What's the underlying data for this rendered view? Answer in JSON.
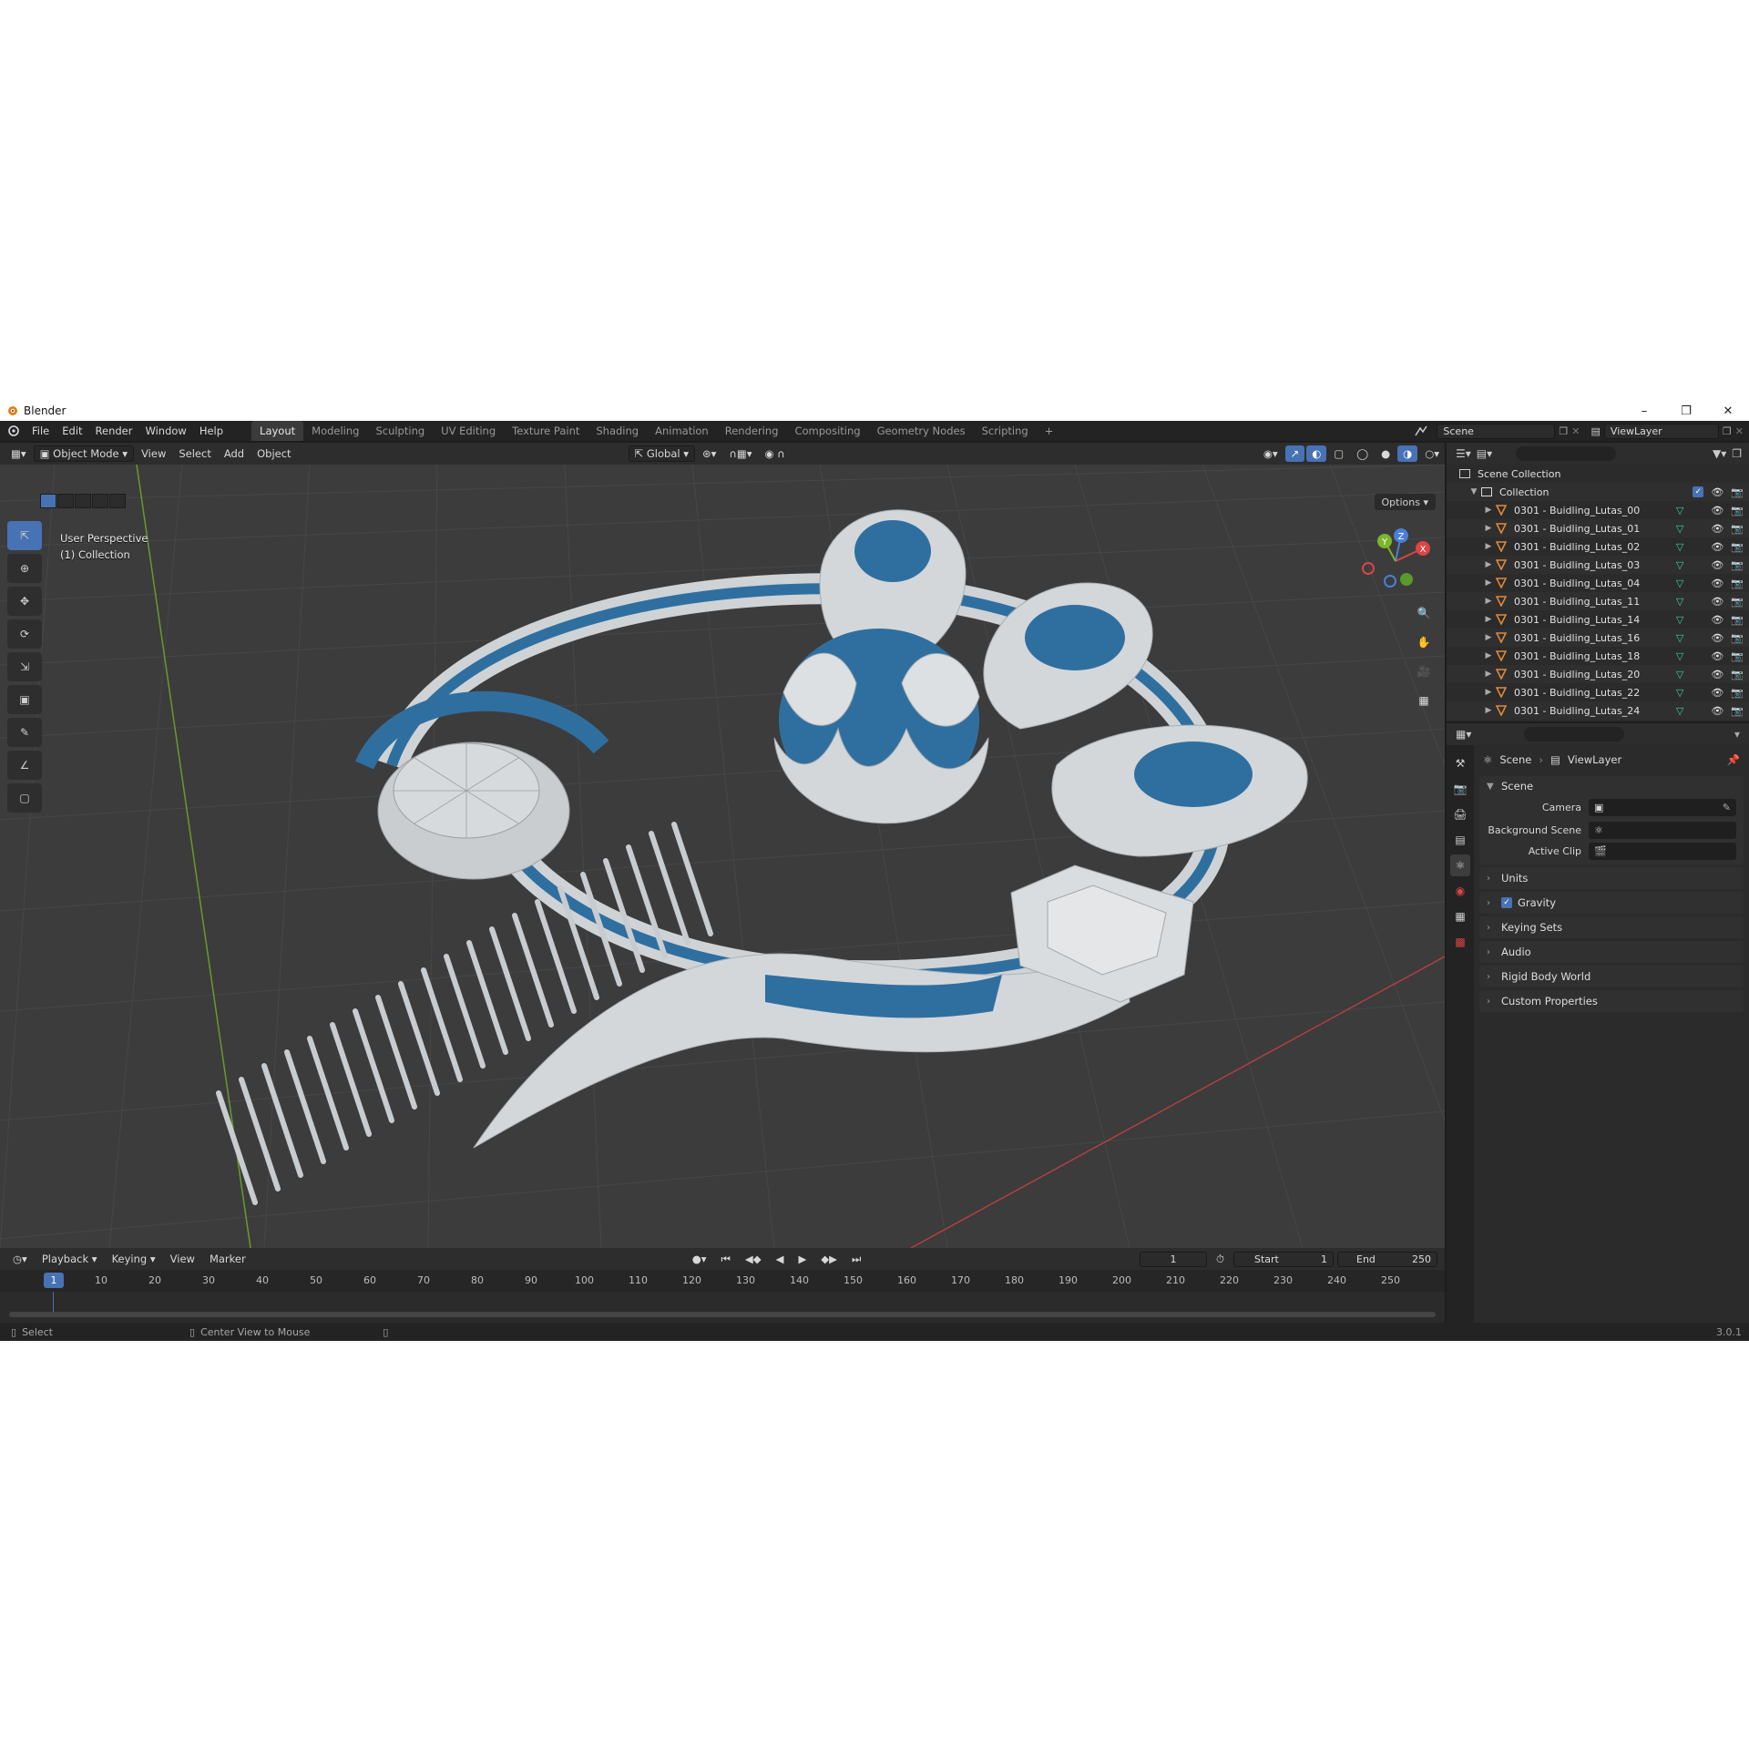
{
  "window": {
    "title": "Blender"
  },
  "menu": [
    "File",
    "Edit",
    "Render",
    "Window",
    "Help"
  ],
  "workspaces": [
    "Layout",
    "Modeling",
    "Sculpting",
    "UV Editing",
    "Texture Paint",
    "Shading",
    "Animation",
    "Rendering",
    "Compositing",
    "Geometry Nodes",
    "Scripting"
  ],
  "scene_field": "Scene",
  "viewlayer_field": "ViewLayer",
  "viewport": {
    "mode": "Object Mode",
    "menus": [
      "View",
      "Select",
      "Add",
      "Object"
    ],
    "orientation": "Global",
    "options_label": "Options",
    "info_line1": "User Perspective",
    "info_line2": "(1) Collection"
  },
  "gizmo": {
    "x": "X",
    "y": "Y",
    "z": "Z"
  },
  "timeline": {
    "menus": [
      "Playback",
      "Keying",
      "View",
      "Marker"
    ],
    "current_frame": "1",
    "start_label": "Start",
    "start_value": "1",
    "end_label": "End",
    "end_value": "250",
    "ruler_current": "1",
    "ticks": [
      "10",
      "20",
      "30",
      "40",
      "50",
      "60",
      "70",
      "80",
      "90",
      "100",
      "110",
      "120",
      "130",
      "140",
      "150",
      "160",
      "170",
      "180",
      "190",
      "200",
      "210",
      "220",
      "230",
      "240",
      "250"
    ]
  },
  "statusbar": {
    "select": "Select",
    "center": "Center View to Mouse",
    "version": "3.0.1"
  },
  "outliner": {
    "scene_collection": "Scene Collection",
    "collection": "Collection",
    "objects": [
      "0301 - Buidling_Lutas_00",
      "0301 - Buidling_Lutas_01",
      "0301 - Buidling_Lutas_02",
      "0301 - Buidling_Lutas_03",
      "0301 - Buidling_Lutas_04",
      "0301 - Buidling_Lutas_11",
      "0301 - Buidling_Lutas_14",
      "0301 - Buidling_Lutas_16",
      "0301 - Buidling_Lutas_18",
      "0301 - Buidling_Lutas_20",
      "0301 - Buidling_Lutas_22",
      "0301 - Buidling_Lutas_24"
    ]
  },
  "properties": {
    "crumb_scene": "Scene",
    "crumb_viewlayer": "ViewLayer",
    "panel_title": "Scene",
    "camera_label": "Camera",
    "background_label": "Background Scene",
    "clip_label": "Active Clip",
    "sections": [
      "Units",
      "Gravity",
      "Keying Sets",
      "Audio",
      "Rigid Body World",
      "Custom Properties"
    ]
  },
  "colors": {
    "accent": "#4772b3",
    "glass": "#2f6fa0",
    "building": "#d4d7da"
  }
}
